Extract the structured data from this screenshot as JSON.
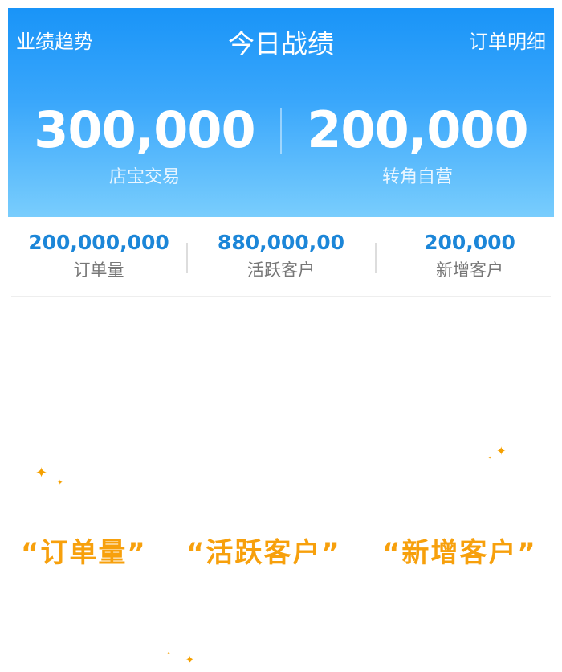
{
  "header": {
    "left_link": "业绩趋势",
    "title": "今日战绩",
    "right_link": "订单明细"
  },
  "hero_stats": [
    {
      "value": "300,000",
      "label": "店宝交易"
    },
    {
      "value": "200,000",
      "label": "转角自营"
    }
  ],
  "stats": [
    {
      "value": "200,000,000",
      "label": "订单量"
    },
    {
      "value": "880,000,00",
      "label": "活跃客户"
    },
    {
      "value": "200,000",
      "label": "新增客户"
    }
  ],
  "highlights": [
    "“订单量”",
    "“活跃客户”",
    "“新增客户”"
  ],
  "colors": {
    "hero_top": "#1994f8",
    "hero_bottom": "#79cdfd",
    "stat_number": "#1c86d8",
    "highlight": "#f7a00c"
  },
  "icons": {
    "sparkle": "sparkle-icon"
  }
}
